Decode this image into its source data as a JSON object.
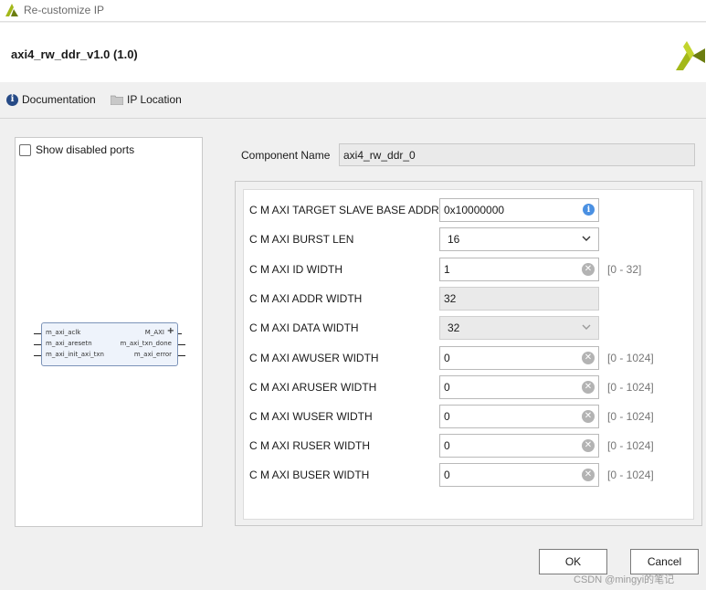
{
  "window": {
    "title": "Re-customize IP",
    "logo_icon": "xilinx-logo-icon",
    "logo_color": "#a3b819"
  },
  "header": {
    "ip_name": "axi4_rw_ddr_v1.0 (1.0)"
  },
  "links": {
    "documentation": "Documentation",
    "ip_location": "IP Location"
  },
  "left_panel": {
    "show_disabled_ports": "Show disabled ports",
    "show_disabled_checked": false,
    "symbol": {
      "left_ports": [
        "m_axi_aclk",
        "m_axi_aresetn",
        "m_axi_init_axi_txn"
      ],
      "right_ports": [
        "M_AXI",
        "m_axi_txn_done",
        "m_axi_error"
      ],
      "plus_symbol": "+"
    }
  },
  "component": {
    "label": "Component Name",
    "value": "axi4_rw_ddr_0"
  },
  "params": [
    {
      "label": "C M AXI TARGET SLAVE BASE ADDR",
      "value": "0x10000000",
      "kind": "text",
      "icon": "info-icon",
      "range": ""
    },
    {
      "label": "C M AXI BURST LEN",
      "value": "16",
      "kind": "select",
      "icon": "chevron-down-icon",
      "range": ""
    },
    {
      "label": "C M AXI ID WIDTH",
      "value": "1",
      "kind": "text",
      "icon": "clear-icon",
      "range": "[0 - 32]"
    },
    {
      "label": "C M AXI ADDR WIDTH",
      "value": "32",
      "kind": "disabled",
      "icon": "",
      "range": ""
    },
    {
      "label": "C M AXI DATA WIDTH",
      "value": "32",
      "kind": "select-disabled",
      "icon": "chevron-down-icon",
      "range": ""
    },
    {
      "label": "C M AXI AWUSER WIDTH",
      "value": "0",
      "kind": "text",
      "icon": "clear-icon",
      "range": "[0 - 1024]"
    },
    {
      "label": "C M AXI ARUSER WIDTH",
      "value": "0",
      "kind": "text",
      "icon": "clear-icon",
      "range": "[0 - 1024]"
    },
    {
      "label": "C M AXI WUSER WIDTH",
      "value": "0",
      "kind": "text",
      "icon": "clear-icon",
      "range": "[0 - 1024]"
    },
    {
      "label": "C M AXI RUSER WIDTH",
      "value": "0",
      "kind": "text",
      "icon": "clear-icon",
      "range": "[0 - 1024]"
    },
    {
      "label": "C M AXI BUSER WIDTH",
      "value": "0",
      "kind": "text",
      "icon": "clear-icon",
      "range": "[0 - 1024]"
    }
  ],
  "buttons": {
    "ok": "OK",
    "cancel": "Cancel"
  },
  "watermark": "CSDN @mingyi的笔记"
}
